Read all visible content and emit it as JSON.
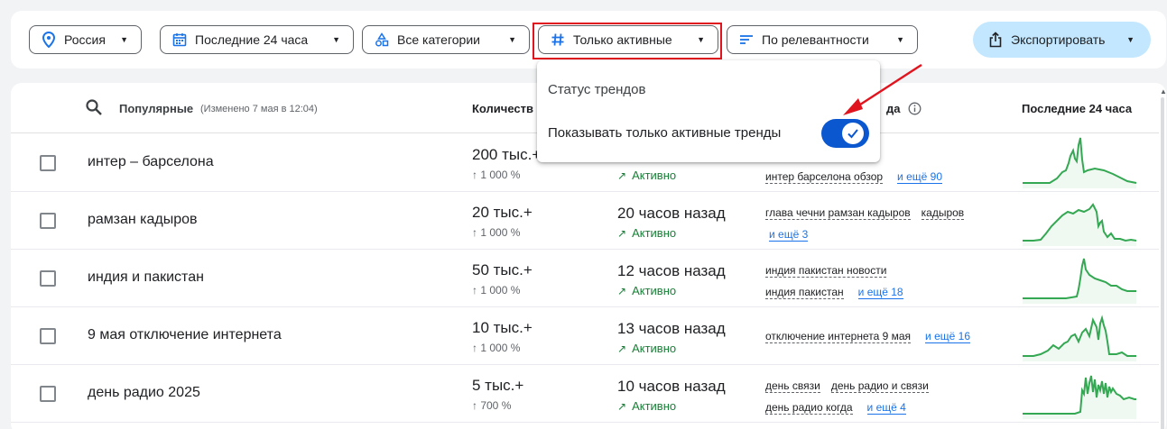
{
  "filters": {
    "location": "Россия",
    "time": "Последние 24 часа",
    "category": "Все категории",
    "status": "Только активные",
    "sort": "По релевантности",
    "export": "Экспортировать"
  },
  "popup": {
    "title": "Статус трендов",
    "option": "Показывать только активные тренды",
    "toggle_on": true
  },
  "table": {
    "header_popular": "Популярные",
    "header_changed": "(Изменено 7 мая в 12:04)",
    "header_volume": "Количеств",
    "header_breakdown": "да",
    "header_chart": "Последние 24 часа",
    "rows": [
      {
        "name": "интер – барселона",
        "volume": "200 тыс.+",
        "pct": "↑ 1 000 %",
        "started": "",
        "status": "Активно",
        "queries": [
          "интер барселона обзор"
        ],
        "more": "и ещё 90"
      },
      {
        "name": "рамзан кадыров",
        "volume": "20 тыс.+",
        "pct": "↑ 1 000 %",
        "started": "20 часов назад",
        "status": "Активно",
        "queries": [
          "глава чечни рамзан кадыров",
          "кадыров"
        ],
        "more": "и ещё 3"
      },
      {
        "name": "индия и пакистан",
        "volume": "50 тыс.+",
        "pct": "↑ 1 000 %",
        "started": "12 часов назад",
        "status": "Активно",
        "queries": [
          "индия пакистан новости",
          "индия пакистан"
        ],
        "more": "и ещё 18"
      },
      {
        "name": "9 мая отключение интернета",
        "volume": "10 тыс.+",
        "pct": "↑ 1 000 %",
        "started": "13 часов назад",
        "status": "Активно",
        "queries": [
          "отключение интернета 9 мая"
        ],
        "more": "и ещё 16"
      },
      {
        "name": "день радио 2025",
        "volume": "5 тыс.+",
        "pct": "↑ 700 %",
        "started": "10 часов назад",
        "status": "Активно",
        "queries": [
          "день связи",
          "день радио и связи",
          "день радио когда"
        ],
        "more": "и ещё 4"
      }
    ]
  },
  "colors": {
    "accent": "#0b57d0",
    "active_green": "#188038",
    "spark_green": "#34a853",
    "highlight_red": "#e0141e"
  }
}
